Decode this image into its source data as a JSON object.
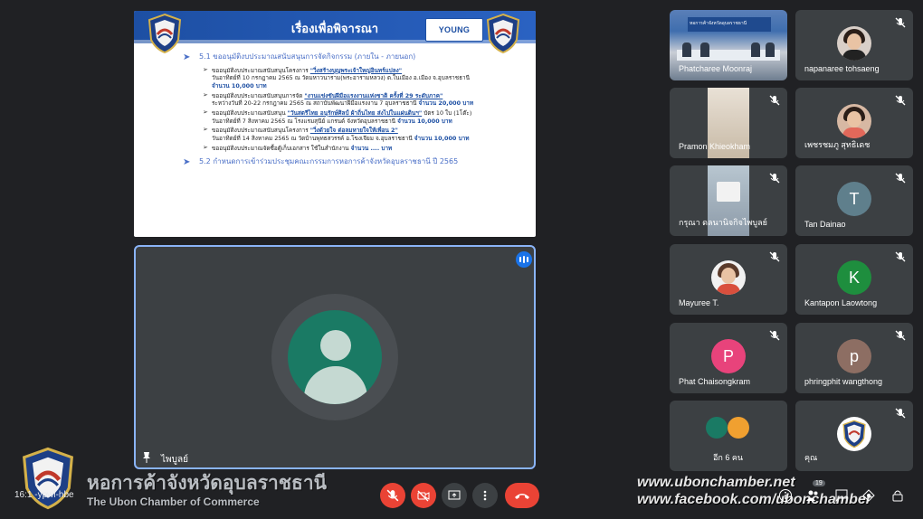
{
  "slide": {
    "title": "เรื่องเพื่อพิจารณา",
    "young_logo": "YOUNG",
    "section1": "5.1 ขออนุมัติงบประมาณสนับสนุนการจัดกิจกรรม (ภายใน - ภายนอก)",
    "items": [
      {
        "line1_prefix": "ขออนุมัติงบประมาณสนับสนุนโครงการ ",
        "line1_u": "\"วิ่งสร้างบุญพระเจ้าใหญ่อินทร์แปลง\"",
        "line2": "วันอาทิตย์ที่ 10 กรกฎาคม 2565 ณ วัดมหาวนาราม(พระอารามหลวง) ต.ในเมือง อ.เมือง จ.อุบลราชธานี",
        "amount": "จำนวน 10,000 บาท"
      },
      {
        "line1_prefix": "ขออนุมัติงบประมาณสนับสนุนการจัด ",
        "line1_u": "\"งานแข่งขันฝีมือแรงงานแห่งชาติ ครั้งที่ 29 ระดับภาค\"",
        "line2": "ระหว่างวันที่ 20-22 กรกฎาคม 2565 ณ สถาบันพัฒนาฝีมือแรงงาน 7 อุบลราชธานี",
        "amount": "จำนวน 20,000 บาท"
      },
      {
        "line1_prefix": "ขออนุมัติงบประมาณสนับสนุน ",
        "line1_u": "\"วันสตรีไทย อนุรักษ์ศิลป์ ผ้าถิ่นไทย ส่งไปในแผ่นดินฯ\"",
        "line1_suffix": " บัตร 10 ใบ (1โต๊ะ)",
        "line2": "วันอาทิตย์ที่ 7 สิงหาคม 2565 ณ โรงแรมสุนีย์ แกรนด์ จังหวัดอุบลราชธานี",
        "amount": "จำนวน 10,000 บาท"
      },
      {
        "line1_prefix": "ขออนุมัติงบประมาณสนับสนุนโครงการ ",
        "line1_u": "\"วิ่งด้วยใจ ต่อลมหายใจให้เพื่อน 2\"",
        "line2": "วันอาทิตย์ที่ 14 สิงหาคม 2565 ณ วัดบ้านพุทธสวรรค์ อ.โขงเจียม จ.อุบลราชธานี",
        "amount": "จำนวน 10,000 บาท"
      },
      {
        "line1_prefix": "ขออนุมัติงบประมาณจัดซื้อตู้เก็บเอกสาร ใช้ในสำนักงาน ",
        "amount": "จำนวน .... บาท"
      }
    ],
    "section2": "5.2 กำหนดการเข้าร่วมประชุมคณะกรรมการหอการค้าจังหวัดอุบลราชธานี ปี 2565"
  },
  "main_tile": {
    "name": "ไพบูลย์"
  },
  "participants": [
    {
      "name": "Phatcharee Moonraj",
      "type": "video-room"
    },
    {
      "name": "napanaree tohsaeng",
      "type": "photo",
      "muted": true
    },
    {
      "name": "Pramon Khieokham",
      "type": "video",
      "muted": true
    },
    {
      "name": "เพชรชมภู สุทธิเดช",
      "type": "photo",
      "muted": true
    },
    {
      "name": "กรุณา ดลนานิจกิจไพบูลย์",
      "type": "video2",
      "muted": true
    },
    {
      "name": "Tan Dainao",
      "type": "letter",
      "letter": "T",
      "color": "#5f7f8c",
      "muted": true
    },
    {
      "name": "Mayuree T.",
      "type": "photo",
      "muted": true
    },
    {
      "name": "Kantapon Laowtong",
      "type": "letter",
      "letter": "K",
      "color": "#1e8e3e",
      "muted": true
    },
    {
      "name": "Phat Chaisongkram",
      "type": "letter",
      "letter": "P",
      "color": "#e8437b",
      "muted": true
    },
    {
      "name": "phringphit wangthong",
      "type": "letter",
      "letter": "p",
      "color": "#8d6e63",
      "muted": true
    },
    {
      "name": "อีก 6 คน",
      "type": "multi"
    },
    {
      "name": "คุณ",
      "type": "logo",
      "muted": true
    }
  ],
  "branding": {
    "thai_name": "หอการค้าจังหวัดอุบลราชธานี",
    "english_name": "The Ubon Chamber of Commerce",
    "website": "www.ubonchamber.net",
    "facebook": "www.facebook.com/ubonchamber"
  },
  "meeting": {
    "time_code": "16:1   -ypwi-hbe"
  },
  "controls": {
    "participants_count": "19",
    "accent_red": "#ea4335",
    "accent_blue": "#8ab4f8"
  }
}
